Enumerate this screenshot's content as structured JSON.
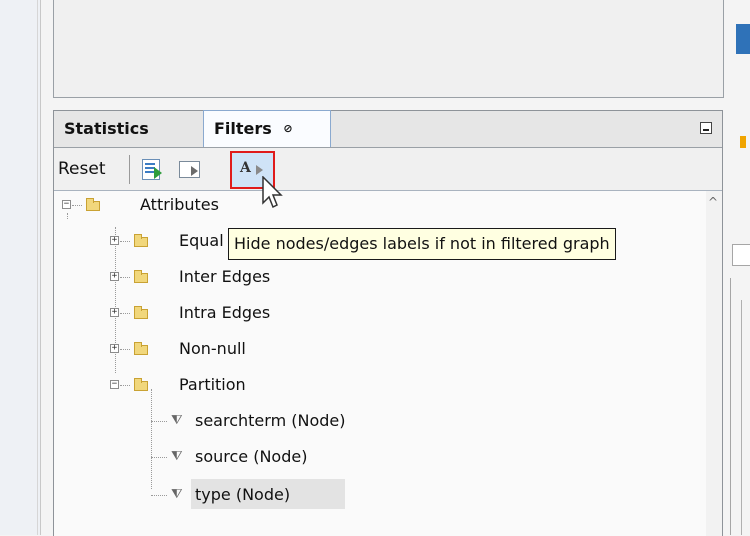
{
  "tabs": [
    {
      "label": "Statistics"
    },
    {
      "label": "Filters",
      "close_glyph": "⊘"
    }
  ],
  "toolbar": {
    "reset_label": "Reset",
    "labels_icon_text": "A"
  },
  "tooltip": {
    "text": "Hide nodes/edges labels if not in filtered graph"
  },
  "tree": {
    "root": "Attributes",
    "children": [
      "Equal",
      "Inter Edges",
      "Intra Edges",
      "Non-null",
      "Partition"
    ],
    "partition_children": [
      "searchterm (Node)",
      "source (Node)",
      "type (Node)"
    ]
  },
  "icons": {
    "expand_minus": "−",
    "expand_plus": "+",
    "funnel": "⧨"
  },
  "colors": {
    "highlight_border": "#e01b1b",
    "tooltip_bg": "#ffffe1",
    "tab_active_border": "#8aa9cf"
  }
}
